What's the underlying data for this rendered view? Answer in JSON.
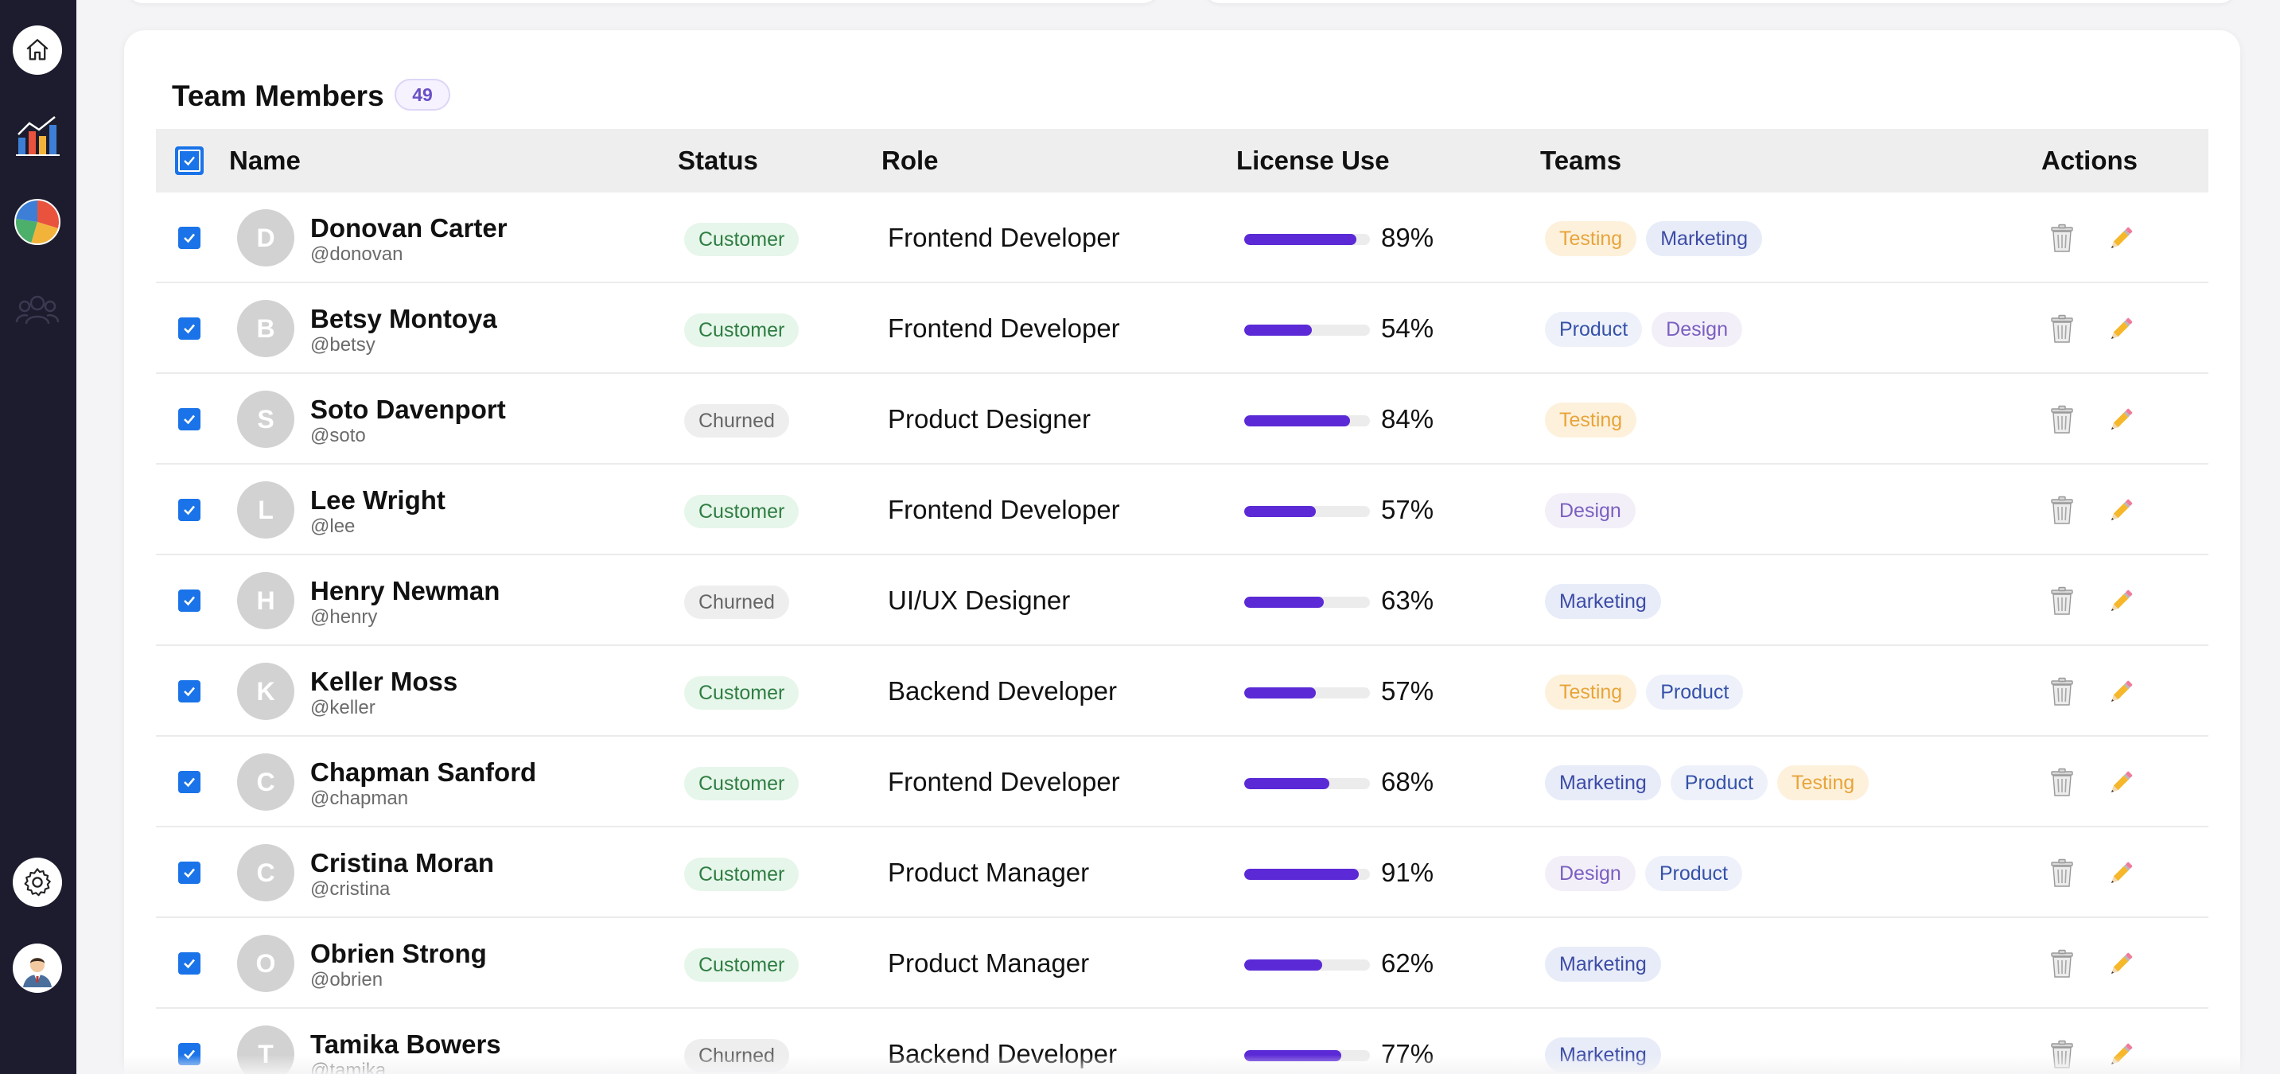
{
  "sidebar": {
    "icons": [
      "home-icon",
      "bar-chart-icon",
      "pie-chart-icon",
      "users-icon",
      "gear-icon",
      "user-avatar-icon"
    ]
  },
  "team": {
    "title": "Team Members",
    "count": "49",
    "headers": {
      "name": "Name",
      "status": "Status",
      "role": "Role",
      "license": "License Use",
      "teams": "Teams",
      "actions": "Actions"
    },
    "rows": [
      {
        "initial": "D",
        "name": "Donovan Carter",
        "handle": "@donovan",
        "status": "Customer",
        "role": "Frontend Developer",
        "license": 89,
        "license_label": "89%",
        "teams": [
          "Testing",
          "Marketing"
        ]
      },
      {
        "initial": "B",
        "name": "Betsy Montoya",
        "handle": "@betsy",
        "status": "Customer",
        "role": "Frontend Developer",
        "license": 54,
        "license_label": "54%",
        "teams": [
          "Product",
          "Design"
        ]
      },
      {
        "initial": "S",
        "name": "Soto Davenport",
        "handle": "@soto",
        "status": "Churned",
        "role": "Product Designer",
        "license": 84,
        "license_label": "84%",
        "teams": [
          "Testing"
        ]
      },
      {
        "initial": "L",
        "name": "Lee Wright",
        "handle": "@lee",
        "status": "Customer",
        "role": "Frontend Developer",
        "license": 57,
        "license_label": "57%",
        "teams": [
          "Design"
        ]
      },
      {
        "initial": "H",
        "name": "Henry Newman",
        "handle": "@henry",
        "status": "Churned",
        "role": "UI/UX Designer",
        "license": 63,
        "license_label": "63%",
        "teams": [
          "Marketing"
        ]
      },
      {
        "initial": "K",
        "name": "Keller Moss",
        "handle": "@keller",
        "status": "Customer",
        "role": "Backend Developer",
        "license": 57,
        "license_label": "57%",
        "teams": [
          "Testing",
          "Product"
        ]
      },
      {
        "initial": "C",
        "name": "Chapman Sanford",
        "handle": "@chapman",
        "status": "Customer",
        "role": "Frontend Developer",
        "license": 68,
        "license_label": "68%",
        "teams": [
          "Marketing",
          "Product",
          "Testing"
        ]
      },
      {
        "initial": "C",
        "name": "Cristina Moran",
        "handle": "@cristina",
        "status": "Customer",
        "role": "Product Manager",
        "license": 91,
        "license_label": "91%",
        "teams": [
          "Design",
          "Product"
        ]
      },
      {
        "initial": "O",
        "name": "Obrien Strong",
        "handle": "@obrien",
        "status": "Customer",
        "role": "Product Manager",
        "license": 62,
        "license_label": "62%",
        "teams": [
          "Marketing"
        ]
      },
      {
        "initial": "T",
        "name": "Tamika Bowers",
        "handle": "@tamika",
        "status": "Churned",
        "role": "Backend Developer",
        "license": 77,
        "license_label": "77%",
        "teams": [
          "Marketing"
        ]
      }
    ]
  },
  "colors": {
    "sidebar": "#1d1c2e",
    "accent": "#5b2ad6",
    "checkbox": "#1a73e8"
  }
}
